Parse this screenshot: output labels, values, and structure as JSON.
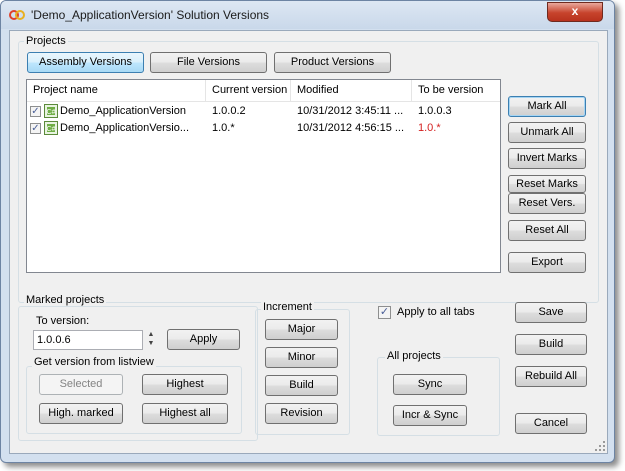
{
  "window": {
    "title": "'Demo_ApplicationVersion' Solution Versions",
    "close_symbol": "x"
  },
  "projects": {
    "group_label": "Projects",
    "tabs": [
      {
        "label": "Assembly Versions",
        "active": true
      },
      {
        "label": "File Versions",
        "active": false
      },
      {
        "label": "Product Versions",
        "active": false
      }
    ],
    "columns": [
      "Project name",
      "Current version",
      "Modified",
      "To be version"
    ],
    "rows": [
      {
        "checked": true,
        "name": "Demo_ApplicationVersion",
        "current": "1.0.0.2",
        "modified": "10/31/2012 3:45:11 ...",
        "to_be": "1.0.0.3",
        "to_be_color": "#000000"
      },
      {
        "checked": true,
        "name": "Demo_ApplicationVersio...",
        "current": "1.0.*",
        "modified": "10/31/2012 4:56:15 ...",
        "to_be": "1.0.*",
        "to_be_color": "#d42020"
      }
    ],
    "side_buttons": {
      "mark_all": "Mark All",
      "unmark_all": "Unmark All",
      "invert_marks": "Invert Marks",
      "reset_marks": "Reset Marks",
      "reset_vers": "Reset Vers.",
      "reset_all": "Reset All",
      "export": "Export"
    }
  },
  "marked_projects": {
    "group_label": "Marked projects",
    "to_version_label": "To version:",
    "to_version_value": "1.0.0.6",
    "apply": "Apply",
    "get_version": {
      "group_label": "Get version from listview",
      "selected": "Selected",
      "highest": "Highest",
      "high_marked": "High. marked",
      "highest_all": "Highest all"
    }
  },
  "increment": {
    "group_label": "Increment",
    "major": "Major",
    "minor": "Minor",
    "build": "Build",
    "revision": "Revision"
  },
  "apply_to_all_tabs": {
    "label": "Apply to all tabs",
    "checked": true
  },
  "all_projects": {
    "group_label": "All projects",
    "sync": "Sync",
    "incr_sync": "Incr & Sync"
  },
  "actions": {
    "save": "Save",
    "build": "Build",
    "rebuild_all": "Rebuild All",
    "cancel": "Cancel"
  }
}
